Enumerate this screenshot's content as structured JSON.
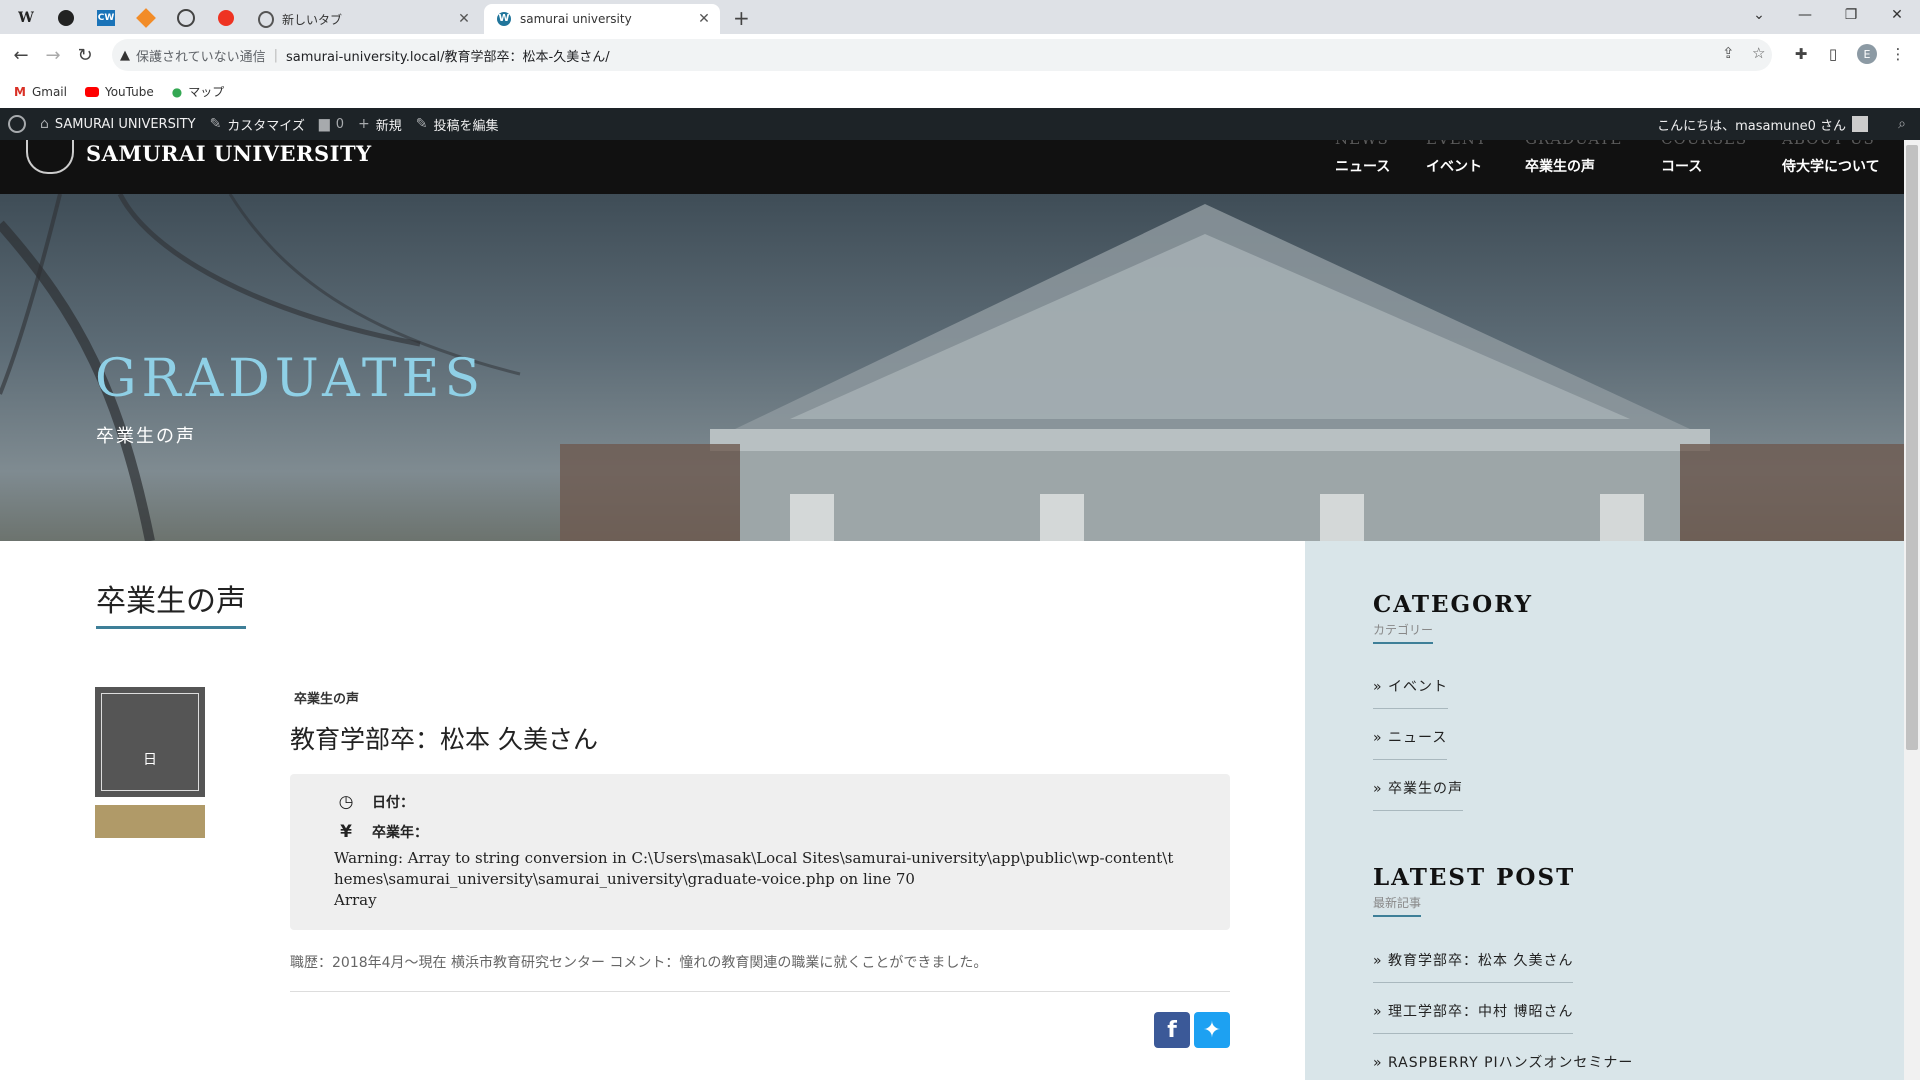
{
  "browser": {
    "tabs": [
      {
        "title": "新しいタブ"
      },
      {
        "title": "samurai university"
      }
    ],
    "security_label": "保護されていない通信",
    "url": "samurai-university.local/教育学部卒：松本-久美さん/",
    "profile_initial": "E",
    "bookmarks": [
      "Gmail",
      "YouTube",
      "マップ"
    ]
  },
  "wp_admin_bar": {
    "site_name": "SAMURAI UNIVERSITY",
    "customize": "カスタマイズ",
    "comments_count": "0",
    "new": "新規",
    "edit_post": "投稿を編集",
    "greeting": "こんにちは、masamune0 さん"
  },
  "site": {
    "logo": "SAMURAI UNIVERSITY",
    "nav": [
      {
        "en": "NEWS",
        "ja": "ニュース"
      },
      {
        "en": "EVENT",
        "ja": "イベント"
      },
      {
        "en": "GRADUATE",
        "ja": "卒業生の声"
      },
      {
        "en": "COURSES",
        "ja": "コース"
      },
      {
        "en": "ABOUT US",
        "ja": "侍大学について"
      }
    ]
  },
  "hero": {
    "title": "GRADUATES",
    "subtitle": "卒業生の声"
  },
  "main": {
    "page_title": "卒業生の声",
    "thumb_label": "日",
    "post": {
      "category": "卒業生の声",
      "title": "教育学部卒：松本 久美さん",
      "date_label": "日付：",
      "grad_year_label": "卒業年：",
      "warning": "Warning: Array to string conversion in C:\\Users\\masak\\Local Sites\\samurai-university\\app\\public\\wp-content\\themes\\samurai_university\\samurai_university\\graduate-voice.php on line 70",
      "array_text": "Array",
      "career": "職歴：2018年4月～現在 横浜市教育研究センター コメント：憧れの教育関連の職業に就くことができました。"
    }
  },
  "sidebar": {
    "category_heading": "CATEGORY",
    "category_sub": "カテゴリー",
    "categories": [
      "» イベント",
      "» ニュース",
      "» 卒業生の声"
    ],
    "latest_heading": "LATEST POST",
    "latest_sub": "最新記事",
    "latest": [
      "» 教育学部卒：松本 久美さん",
      "» 理工学部卒：中村 博昭さん",
      "» RASPBERRY PIハンズオンセミナー"
    ]
  },
  "colors": {
    "accent": "#3e7f98",
    "gold": "#b09a68",
    "hero_title": "#8fd0e6",
    "facebook": "#3b5998",
    "twitter": "#1da1f2"
  }
}
